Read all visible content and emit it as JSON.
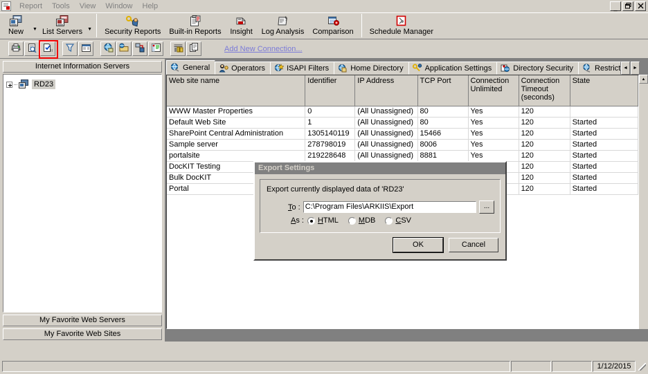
{
  "window": {
    "minimize_label": "_",
    "restore_label": "❐",
    "close_label": "✕"
  },
  "menubar": {
    "items": [
      {
        "label": "Report"
      },
      {
        "label": "Tools"
      },
      {
        "label": "View"
      },
      {
        "label": "Window"
      },
      {
        "label": "Help"
      }
    ]
  },
  "main_toolbar": {
    "items": [
      {
        "label": "New",
        "icon": "server-new-icon",
        "has_dropdown": true
      },
      {
        "label": "List Servers",
        "icon": "server-list-icon",
        "has_dropdown": true
      },
      {
        "label": "Security Reports",
        "icon": "key-security-icon",
        "has_dropdown": false
      },
      {
        "label": "Built-in Reports",
        "icon": "clipboard-report-icon",
        "has_dropdown": false
      },
      {
        "label": "Insight",
        "icon": "insight-printer-icon",
        "has_dropdown": false
      },
      {
        "label": "Log Analysis",
        "icon": "log-analysis-icon",
        "has_dropdown": false
      },
      {
        "label": "Comparison",
        "icon": "comparison-icon",
        "has_dropdown": false
      },
      {
        "label": "Schedule Manager",
        "icon": "schedule-manager-icon",
        "has_dropdown": false
      }
    ],
    "dropdown_glyph": "▼"
  },
  "small_toolbar": {
    "buttons": [
      {
        "name": "print-icon"
      },
      {
        "name": "print-preview-icon"
      },
      {
        "name": "export-icon",
        "highlighted": true
      },
      {
        "name": "filter-icon"
      },
      {
        "name": "report-view-icon"
      },
      {
        "name": "globe-connect-icon"
      },
      {
        "name": "open-folder-icon"
      },
      {
        "name": "network-icon"
      },
      {
        "name": "properties-icon"
      },
      {
        "name": "chart-lock-icon"
      },
      {
        "name": "copy-icon"
      }
    ],
    "add_connection_link": "Add New Connection...",
    "highlight_color": "#ee0000"
  },
  "left_panel": {
    "title": "Internet Information Servers",
    "tree": [
      {
        "label": "RD23",
        "expandable": true,
        "selected": true,
        "icon": "server-icon"
      }
    ],
    "buttons": [
      {
        "label": "My Favorite Web Servers"
      },
      {
        "label": "My Favorite Web Sites"
      }
    ]
  },
  "tabs": {
    "items": [
      {
        "label": "General",
        "icon": "globe-general-icon",
        "active": true
      },
      {
        "label": "Operators",
        "icon": "operators-icon",
        "active": false
      },
      {
        "label": "ISAPI Filters",
        "icon": "isapi-filters-icon",
        "active": false
      },
      {
        "label": "Home Directory",
        "icon": "home-directory-icon",
        "active": false
      },
      {
        "label": "Application Settings",
        "icon": "app-settings-key-icon",
        "active": false
      },
      {
        "label": "Directory Security",
        "icon": "directory-security-icon",
        "active": false
      },
      {
        "label": "Restrict",
        "icon": "restrict-icon",
        "active": false
      }
    ],
    "scroll_left_glyph": "◄",
    "scroll_right_glyph": "►"
  },
  "grid": {
    "columns": [
      "Web site name",
      "Identifier",
      "IP Address",
      "TCP Port",
      "Connection Unlimited",
      "Connection Timeout (seconds)",
      "State"
    ],
    "rows": [
      [
        "WWW Master Properties",
        "0",
        "(All Unassigned)",
        "80",
        "Yes",
        "120",
        ""
      ],
      [
        "Default Web Site",
        "1",
        "(All Unassigned)",
        "80",
        "Yes",
        "120",
        "Started"
      ],
      [
        "SharePoint Central Administration",
        "1305140119",
        "(All Unassigned)",
        "15466",
        "Yes",
        "120",
        "Started"
      ],
      [
        "Sample server",
        "278798019",
        "(All Unassigned)",
        "8006",
        "Yes",
        "120",
        "Started"
      ],
      [
        "portalsite",
        "219228648",
        "(All Unassigned)",
        "8881",
        "Yes",
        "120",
        "Started"
      ],
      [
        "DocKIT Testing",
        "",
        "",
        "",
        "",
        "120",
        "Started"
      ],
      [
        "Bulk DocKIT",
        "",
        "",
        "",
        "",
        "120",
        "Started"
      ],
      [
        "Portal",
        "",
        "",
        "",
        "",
        "120",
        "Started"
      ]
    ]
  },
  "dialog": {
    "title": "Export Settings",
    "description": "Export currently displayed data of 'RD23'",
    "to_label": "To :",
    "to_value": "C:\\Program Files\\ARKIIS\\Export",
    "browse_label": "...",
    "as_label": "As :",
    "formats": [
      {
        "label": "HTML",
        "selected": true
      },
      {
        "label": "MDB",
        "selected": false
      },
      {
        "label": "CSV",
        "selected": false
      }
    ],
    "ok_label": "OK",
    "cancel_label": "Cancel"
  },
  "statusbar": {
    "panes": [
      "",
      "",
      ""
    ],
    "date": "1/12/2015"
  }
}
